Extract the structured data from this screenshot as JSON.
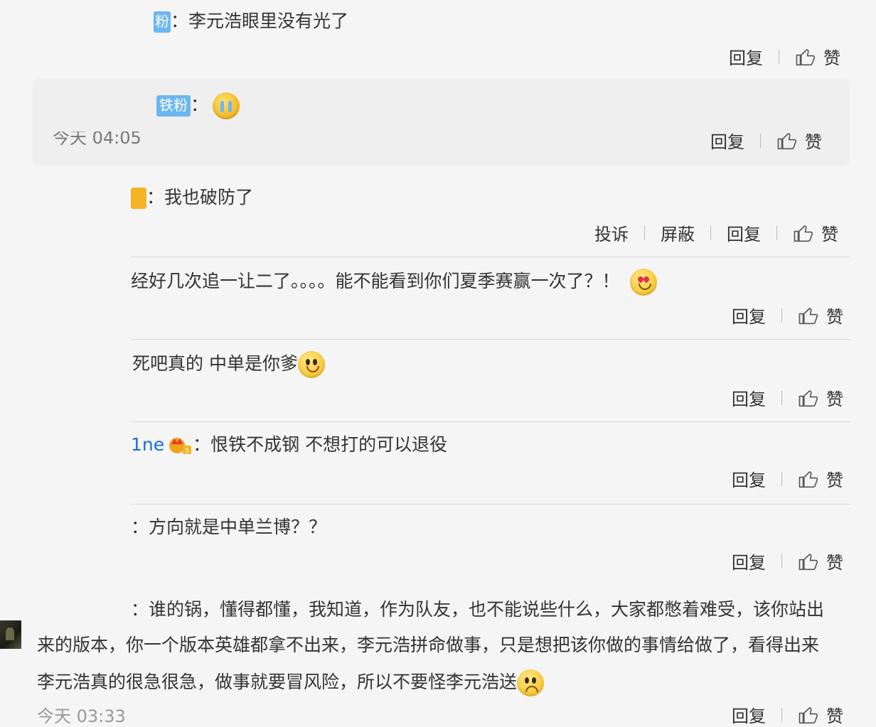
{
  "comments": [
    {
      "user": "",
      "badge": "粉",
      "text": "李元浩眼里没有光了",
      "actions": [
        "回复",
        "赞"
      ]
    },
    {
      "user": "",
      "badge": "铁粉",
      "emoji": "cry-emoji",
      "time": "今天 04:05",
      "actions": [
        "回复",
        "赞"
      ]
    },
    {
      "user": "",
      "badge": "",
      "text": "我也破防了",
      "actions": [
        "投诉",
        "屏蔽",
        "回复",
        "赞"
      ]
    },
    {
      "user": "",
      "text": "经好几次追一让二了。。。。能不能看到你们夏季赛赢一次了？！",
      "emoji": "hearts-eyes-emoji",
      "actions": [
        "回复",
        "赞"
      ]
    },
    {
      "user": "",
      "text": "死吧真的 中单是你爹",
      "emoji": "smile-emoji",
      "actions": [
        "回复",
        "赞"
      ]
    },
    {
      "user": "1ne",
      "text": "恨铁不成钢 不想打的可以退役",
      "actions": [
        "回复",
        "赞"
      ]
    },
    {
      "user": "",
      "text": "方向就是中单兰博？？",
      "actions": [
        "回复",
        "赞"
      ]
    },
    {
      "user": "",
      "text_lines": [
        "谁的锅，懂得都懂，我知道，作为队友，也不能说些什么，大家都憋着难受，该你站出",
        "来的版本，你一个版本英雄都拿不出来，李元浩拼命做事，只是想把该你做的事情给做了，看得出来",
        "李元浩真的很急很急，做事就要冒风险，所以不要怪李元浩送"
      ],
      "emoji": "sad-emoji",
      "time": "今天 03:33",
      "actions": [
        "回复",
        "赞"
      ]
    }
  ],
  "colon": "：",
  "icons": {
    "like": "thumbs-up-icon"
  },
  "colors": {
    "username": "#1a6fd1",
    "badge_blue": "#6cb6f0",
    "badge_gold": "#f5b325",
    "text": "#333333",
    "time": "#999999",
    "divider": "#d8d8d8"
  }
}
